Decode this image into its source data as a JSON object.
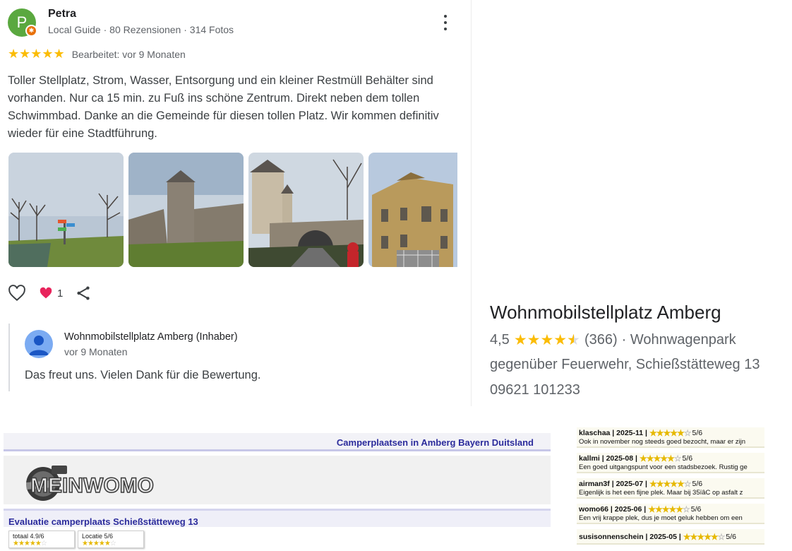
{
  "review": {
    "avatar_letter": "P",
    "name": "Petra",
    "meta": "Local Guide · 80 Rezensionen · 314 Fotos",
    "stars": "★★★★★",
    "edited": "Bearbeitet: vor 9 Monaten",
    "text": "Toller Stellplatz, Strom, Wasser, Entsorgung und ein kleiner Restmüll Behälter sind vorhanden. Nur ca 15 min. zu Fuß ins schöne Zentrum. Direkt neben dem tollen Schwimmbad. Danke an die Gemeinde für diesen tollen Platz. Wir kommen definitiv wieder für eine Stadtführung.",
    "like_count": "1",
    "owner_reply": {
      "name": "Wohnmobilstellplatz Amberg (Inhaber)",
      "time": "vor 9 Monaten",
      "text": "Das freut uns. Vielen Dank für die Bewertung."
    }
  },
  "place": {
    "name": "Wohnmobilstellplatz Amberg",
    "rating": "4,5",
    "stars_full": "★★★★",
    "rating_value": 4.5,
    "count": "(366)",
    "type": "· Wohnwagenpark",
    "address": "gegenüber Feuerwehr, Schießstätteweg 13",
    "phone": "09621 101233"
  },
  "site": {
    "header_title": "Camperplaatsen in Amberg Bayern Duitsland",
    "logo_text": "MEINWOMO",
    "section_title": "Evaluatie camperplaats Schießstätteweg 13",
    "scores": [
      {
        "label": "totaal 4.9/6",
        "full": "★★★★★",
        "empty": "☆"
      },
      {
        "label": "Locatie 5/6",
        "full": "★★★★★",
        "empty": "☆"
      }
    ]
  },
  "dutch_reviews": [
    {
      "user": "klaschaa",
      "date": "2025-11",
      "score": "5/6",
      "full": "★★★★★",
      "empty": "☆",
      "text": "Ook in november nog steeds goed bezocht, maar er zijn"
    },
    {
      "user": "kallmi",
      "date": "2025-08",
      "score": "5/6",
      "full": "★★★★★",
      "empty": "☆",
      "text": "Een goed uitgangspunt voor een stadsbezoek. Rustig ge"
    },
    {
      "user": "airman3f",
      "date": "2025-07",
      "score": "5/6",
      "full": "★★★★★",
      "empty": "☆",
      "text": "Eigenlijk is het een fijne plek. Maar bij 35ïâC op asfalt z"
    },
    {
      "user": "womo66",
      "date": "2025-06",
      "score": "5/6",
      "full": "★★★★★",
      "empty": "☆",
      "text": "Een vrij krappe plek, dus je moet geluk hebben om een"
    },
    {
      "user": "susisonnenschein",
      "date": "2025-05",
      "score": "5/6",
      "full": "★★★★★",
      "empty": "☆",
      "text": ""
    }
  ],
  "icons": {
    "heart_outline": "heart-outline-icon",
    "heart_filled": "heart-filled-icon",
    "share": "share-icon",
    "more": "more-vert-icon",
    "star_color": "#fbbc04",
    "like_color": "#e8245c"
  }
}
